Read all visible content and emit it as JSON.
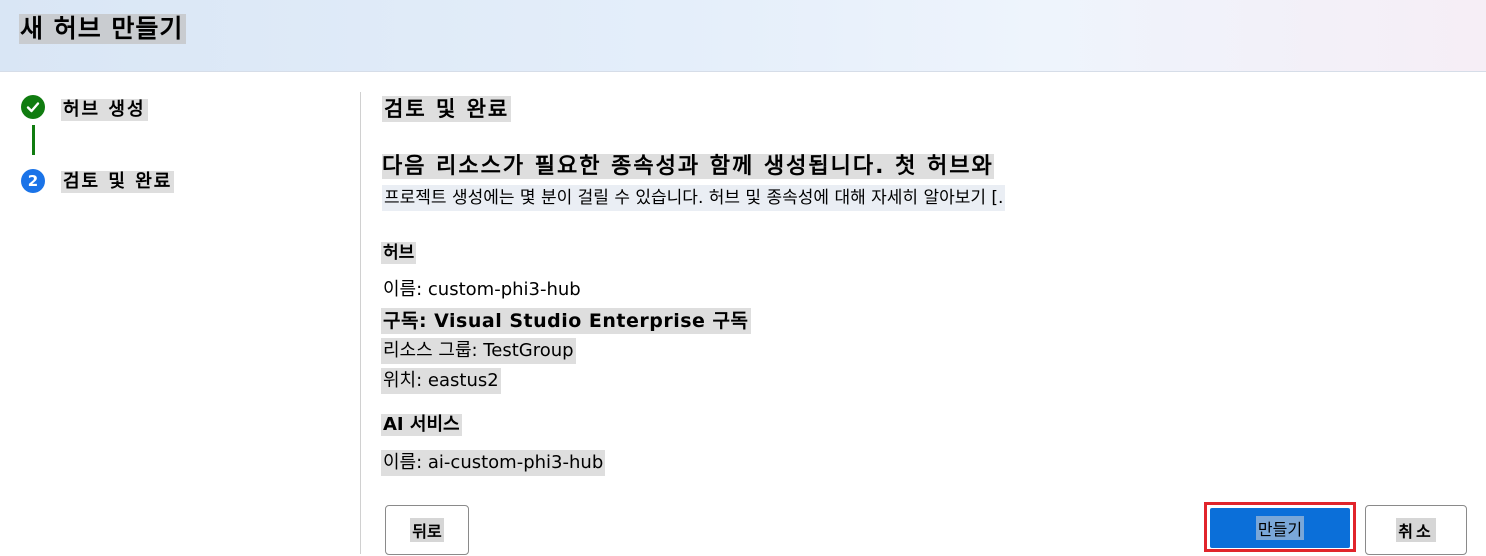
{
  "header": {
    "title": "새 허브 만들기"
  },
  "steps": [
    {
      "label": "허브 생성",
      "status": "done",
      "icon": "checkmark-icon"
    },
    {
      "label": "검토 및 완료",
      "status": "current",
      "number": "2"
    }
  ],
  "main": {
    "section_title": "검토 및 완료",
    "description_line1": "다음 리소스가 필요한 종속성과 함께 생성됩니다. 첫 허브와",
    "description_line2": "프로젝트 생성에는 몇 분이 걸릴 수 있습니다. 허브 및 종속성에 대해 자세히 알아보기 [.",
    "hub": {
      "heading": "허브",
      "name": "이름: custom-phi3-hub",
      "subscription": "구독: Visual Studio Enterprise 구독",
      "resource_group": "리소스 그룹: TestGroup",
      "location": "위치: eastus2"
    },
    "ai_services": {
      "heading": "AI 서비스",
      "name": "이름: ai-custom-phi3-hub"
    }
  },
  "buttons": {
    "back": "뒤로",
    "create": "만들기",
    "cancel": "취소"
  },
  "colors": {
    "success": "#107c10",
    "accent": "#0b6fd9",
    "highlight_border": "#e1242b"
  }
}
